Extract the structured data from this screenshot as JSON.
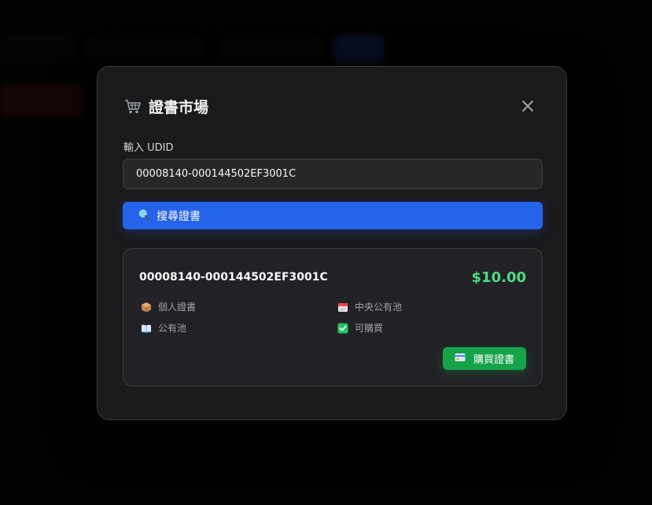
{
  "modal": {
    "title": "證書市場",
    "title_icon": "cart-icon",
    "close_icon": "close-icon"
  },
  "form": {
    "udid_label": "輸入 UDID",
    "udid_value": "00008140-000144502EF3001C",
    "search_button_label": "搜尋證書",
    "search_icon": "magnifier-icon"
  },
  "result": {
    "udid": "00008140-000144502EF3001C",
    "price": "$10.00",
    "attributes": [
      {
        "icon": "package-icon",
        "label": "個人證書"
      },
      {
        "icon": "calendar-icon",
        "label": "中央公有池"
      },
      {
        "icon": "book-icon",
        "label": "公有池"
      },
      {
        "icon": "checkmark-icon",
        "label": "可購買"
      }
    ],
    "buy_button_label": "購買證書",
    "buy_icon": "credit-card-icon"
  },
  "colors": {
    "primary": "#2563eb",
    "success": "#16a34a",
    "price": "#4ade80",
    "modal_bg": "#1a1a1c"
  }
}
